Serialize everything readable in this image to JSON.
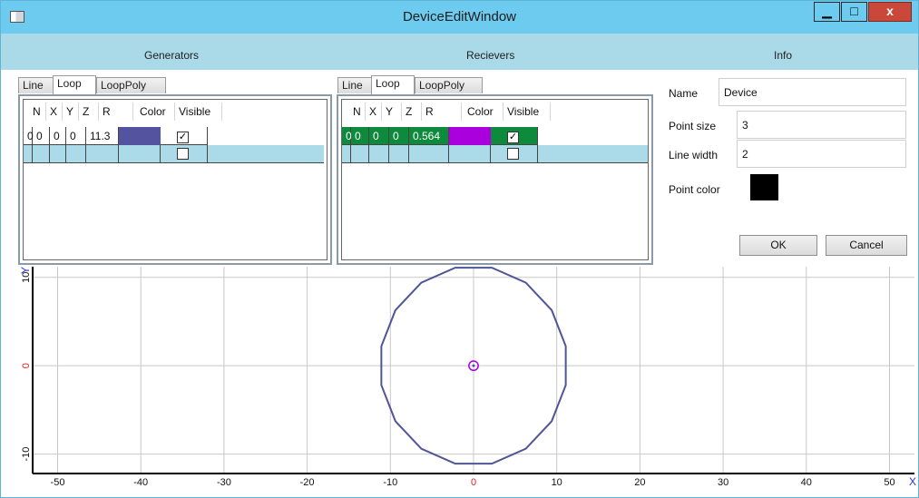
{
  "window": {
    "title": "DeviceEditWindow",
    "controls": {
      "minimize": "▁",
      "maximize": "□",
      "close": "x"
    }
  },
  "headers": {
    "generators": "Generators",
    "receivers": "Recievers",
    "info": "Info"
  },
  "generators": {
    "tabs": [
      "Line",
      "Loop",
      "LoopPoly"
    ],
    "active_tab": "Loop",
    "columns": [
      "N",
      "X",
      "Y",
      "Z",
      "R",
      "Color",
      "Visible"
    ],
    "rows": [
      {
        "N": "0",
        "X": "0",
        "Y": "0",
        "Z": "0",
        "R": "11.3",
        "color": "#5453a0",
        "visible": true
      }
    ]
  },
  "receivers": {
    "tabs": [
      "Line",
      "Loop",
      "LoopPoly"
    ],
    "active_tab": "Loop",
    "columns": [
      "N",
      "X",
      "Y",
      "Z",
      "R",
      "Color",
      "Visible"
    ],
    "rows": [
      {
        "N": "0",
        "X": "0",
        "Y": "0",
        "Z": "0",
        "R": "0.564",
        "color": "#aa00dd",
        "visible": true
      }
    ]
  },
  "info": {
    "name_label": "Name",
    "name_value": "Device",
    "point_size_label": "Point size",
    "point_size_value": "3",
    "line_width_label": "Line width",
    "line_width_value": "2",
    "point_color_label": "Point color",
    "point_color": "#000000",
    "ok_label": "OK",
    "cancel_label": "Cancel"
  },
  "colors": {
    "titlebar": "#6ccbee",
    "header": "#aad9e7",
    "selected_row": "#0d8a3c",
    "new_row": "#abdbe8",
    "loop_line": "#4f5597",
    "axis_zero": "#e02020"
  },
  "plot": {
    "x_axis_label": "X",
    "y_axis_label": "Y",
    "x_ticks": [
      "-50",
      "-40",
      "-30",
      "-20",
      "-10",
      "0",
      "10",
      "20",
      "30",
      "40",
      "50"
    ],
    "y_ticks": [
      "10",
      "0",
      "-10"
    ],
    "xlim": [
      -53,
      53
    ],
    "ylim": [
      -12.2,
      11.2
    ],
    "generator_loop": {
      "cx": 0,
      "cy": 0,
      "r": 11.3,
      "segments": 16
    },
    "receiver_loop": {
      "cx": 0,
      "cy": 0,
      "r": 0.564
    }
  }
}
